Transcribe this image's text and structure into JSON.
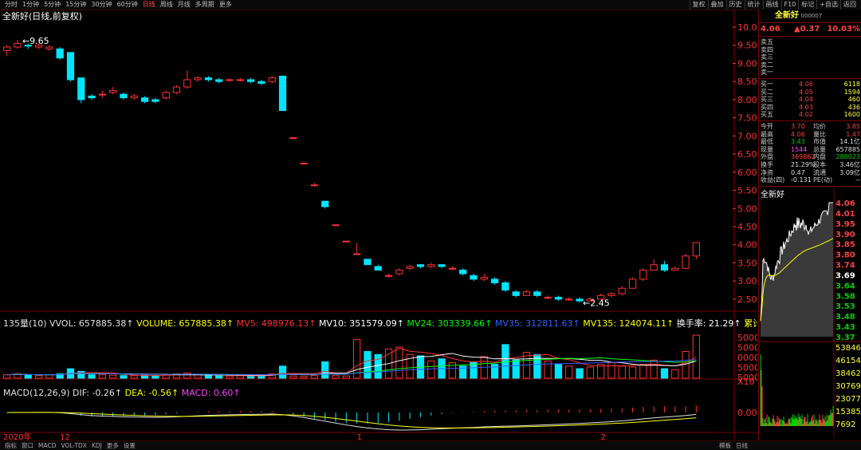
{
  "toolbar": {
    "periods": [
      "分时",
      "1分钟",
      "5分钟",
      "15分钟",
      "30分钟",
      "60分钟",
      "日线",
      "周线",
      "月线",
      "多周期",
      "更多"
    ],
    "active_period": "日线",
    "right_buttons": [
      "复权",
      "叠加",
      "历史",
      "统计",
      "画线",
      "F10",
      "标记",
      "+自选",
      "返回"
    ]
  },
  "chart_title": "全新好(日线,前复权)",
  "price_axis_labels": [
    "10.00",
    "9.50",
    "9.00",
    "8.50",
    "8.00",
    "7.50",
    "7.00",
    "6.50",
    "6.00",
    "5.50",
    "5.00",
    "4.50",
    "4.00",
    "3.50",
    "3.00",
    "2.50"
  ],
  "annotations": {
    "high": "9.65",
    "low": "2.45"
  },
  "volume_legend": [
    {
      "text": "135量(10) VVOL: 657885.38↑",
      "color": "#e0e0e0"
    },
    {
      "text": "VOLUME: 657885.38↑",
      "color": "#ffff00"
    },
    {
      "text": "MV5: 498976.13↑",
      "color": "#ff3030"
    },
    {
      "text": "MV10: 351579.09↑",
      "color": "#ffffff"
    },
    {
      "text": "MV24: 303339.66↑",
      "color": "#00ff00"
    },
    {
      "text": "MV35: 312811.63↑",
      "color": "#3060ff"
    },
    {
      "text": "MV135: 124074.11↑",
      "color": "#ffff00"
    },
    {
      "text": "换手率: 21.29↑",
      "color": "#ffffff"
    },
    {
      "text": "累计换手:",
      "color": "#ffff00"
    }
  ],
  "volume_axis_labels": [
    "5000",
    "5000",
    "0000",
    "5000",
    "5000"
  ],
  "volume_axis_unit": "X10",
  "macd_legend": [
    {
      "text": "MACD(12,26,9) DIF: -0.26↑",
      "color": "#e0e0e0"
    },
    {
      "text": "DEA: -0.56↑",
      "color": "#ffff00"
    },
    {
      "text": "MACD: 0.60↑",
      "color": "#ff40ff"
    }
  ],
  "macd_axis_label": "0.00",
  "date_labels": [
    "2020年",
    "12",
    "1",
    "2"
  ],
  "quote": {
    "name": "全新好",
    "code": "000007",
    "price": "4.06",
    "change": "▲0.37",
    "pct": "10.03%",
    "asks": [
      {
        "label": "卖五",
        "price": "",
        "vol": ""
      },
      {
        "label": "卖四",
        "price": "",
        "vol": ""
      },
      {
        "label": "卖三",
        "price": "",
        "vol": ""
      },
      {
        "label": "卖二",
        "price": "",
        "vol": ""
      },
      {
        "label": "卖一",
        "price": "",
        "vol": ""
      }
    ],
    "bids": [
      {
        "label": "买一",
        "price": "4.06",
        "vol": "6118"
      },
      {
        "label": "买二",
        "price": "4.05",
        "vol": "1594"
      },
      {
        "label": "买三",
        "price": "4.04",
        "vol": "460"
      },
      {
        "label": "买四",
        "price": "4.03",
        "vol": "436"
      },
      {
        "label": "买五",
        "price": "4.02",
        "vol": "1600"
      }
    ],
    "stats": [
      {
        "l1": "今开",
        "v1": "3.70",
        "c1": "#ff4040",
        "l2": "均价",
        "v2": "3.85",
        "c2": "#ff4040"
      },
      {
        "l1": "最高",
        "v1": "4.06",
        "c1": "#ff4040",
        "l2": "量比",
        "v2": "1.47",
        "c2": "#ff4040"
      },
      {
        "l1": "最低",
        "v1": "3.43",
        "c1": "#00d000",
        "l2": "市值",
        "v2": "14.1亿",
        "c2": "#dddddd"
      },
      {
        "l1": "现量",
        "v1": "1544",
        "c1": "#ff40ff",
        "l2": "总量",
        "v2": "657885",
        "c2": "#dddddd"
      },
      {
        "l1": "外盘",
        "v1": "369862",
        "c1": "#ff4040",
        "l2": "内盘",
        "v2": "288023",
        "c2": "#00d000"
      },
      {
        "l1": "换手",
        "v1": "21.29%",
        "c1": "#dddddd",
        "l2": "股本",
        "v2": "3.46亿",
        "c2": "#dddddd"
      },
      {
        "l1": "净资",
        "v1": "0.47",
        "c1": "#dddddd",
        "l2": "流通",
        "v2": "3.09亿",
        "c2": "#dddddd"
      },
      {
        "l1": "收益(四)",
        "v1": "-0.131",
        "c1": "#dddddd",
        "l2": "PE(动)",
        "v2": "--",
        "c2": "#dddddd"
      }
    ]
  },
  "mini_chart": {
    "name": "全新好",
    "price_labels": [
      {
        "v": "4.06",
        "c": "#ff4040"
      },
      {
        "v": "4.01",
        "c": "#ff4040"
      },
      {
        "v": "3.95",
        "c": "#ff4040"
      },
      {
        "v": "3.90",
        "c": "#ff4040"
      },
      {
        "v": "3.85",
        "c": "#ff4040"
      },
      {
        "v": "3.80",
        "c": "#ff4040"
      },
      {
        "v": "3.74",
        "c": "#ff4040"
      },
      {
        "v": "3.69",
        "c": "#ffffff"
      },
      {
        "v": "3.64",
        "c": "#00d000"
      },
      {
        "v": "3.58",
        "c": "#00d000"
      },
      {
        "v": "3.53",
        "c": "#00d000"
      },
      {
        "v": "3.48",
        "c": "#00d000"
      },
      {
        "v": "3.43",
        "c": "#00d000"
      },
      {
        "v": "3.37",
        "c": "#00d000"
      }
    ],
    "vol_labels": [
      "53846",
      "46154",
      "38462",
      "30769",
      "23077",
      "15385",
      "7692"
    ]
  },
  "bottom_tabs": [
    "指标",
    "窗口",
    "MACD",
    "VOL-TDX",
    "KDJ",
    "更多",
    "设置"
  ],
  "bottom_right": [
    "模板",
    "日线"
  ],
  "colors": {
    "up": "#ff3030",
    "down": "#00e5ff",
    "grid_red": "#7a0000"
  },
  "chart_data": {
    "type": "candlestick",
    "title": "全新好(日线,前复权)",
    "y_range": [
      2.3,
      10.0
    ],
    "date_labels": [
      "2020年",
      "12",
      "1",
      "2"
    ],
    "candles": [
      [
        9.35,
        9.45,
        9.2,
        9.5
      ],
      [
        9.45,
        9.55,
        9.4,
        9.65
      ],
      [
        9.5,
        9.48,
        9.4,
        9.55
      ],
      [
        9.45,
        9.5,
        9.4,
        9.55
      ],
      [
        9.4,
        9.45,
        9.35,
        9.5
      ],
      [
        9.4,
        9.15,
        9.1,
        9.45
      ],
      [
        9.3,
        8.55,
        8.5,
        9.3
      ],
      [
        8.6,
        8.0,
        7.9,
        8.6
      ],
      [
        8.1,
        8.05,
        8.0,
        8.15
      ],
      [
        8.15,
        8.15,
        8.05,
        8.25
      ],
      [
        8.2,
        8.25,
        8.15,
        8.35
      ],
      [
        8.15,
        8.05,
        8.0,
        8.2
      ],
      [
        8.05,
        8.1,
        8.0,
        8.15
      ],
      [
        8.05,
        7.95,
        7.9,
        8.1
      ],
      [
        8.0,
        7.95,
        7.9,
        8.05
      ],
      [
        8.05,
        8.2,
        8.0,
        8.25
      ],
      [
        8.2,
        8.35,
        8.15,
        8.4
      ],
      [
        8.35,
        8.55,
        8.3,
        8.8
      ],
      [
        8.55,
        8.6,
        8.5,
        8.65
      ],
      [
        8.6,
        8.55,
        8.5,
        8.65
      ],
      [
        8.55,
        8.5,
        8.45,
        8.6
      ],
      [
        8.55,
        8.55,
        8.5,
        8.6
      ],
      [
        8.55,
        8.55,
        8.5,
        8.6
      ],
      [
        8.55,
        8.5,
        8.45,
        8.6
      ],
      [
        8.5,
        8.45,
        8.4,
        8.55
      ],
      [
        8.5,
        8.6,
        8.45,
        8.65
      ],
      [
        8.65,
        7.7,
        7.7,
        8.65
      ],
      [
        6.95,
        6.95,
        6.95,
        6.95
      ],
      [
        6.25,
        6.25,
        6.25,
        6.25
      ],
      [
        5.65,
        5.65,
        5.6,
        5.7
      ],
      [
        5.2,
        5.05,
        5.0,
        5.2
      ],
      [
        4.55,
        4.55,
        4.55,
        4.55
      ],
      [
        4.1,
        4.1,
        4.1,
        4.1
      ],
      [
        3.75,
        3.75,
        3.75,
        4.05
      ],
      [
        3.6,
        3.45,
        3.45,
        3.6
      ],
      [
        3.4,
        3.3,
        3.3,
        3.45
      ],
      [
        3.15,
        3.15,
        3.1,
        3.2
      ],
      [
        3.2,
        3.3,
        3.15,
        3.35
      ],
      [
        3.35,
        3.4,
        3.3,
        3.45
      ],
      [
        3.45,
        3.4,
        3.35,
        3.45
      ],
      [
        3.4,
        3.45,
        3.35,
        3.5
      ],
      [
        3.45,
        3.4,
        3.35,
        3.45
      ],
      [
        3.35,
        3.35,
        3.3,
        3.4
      ],
      [
        3.3,
        3.2,
        3.15,
        3.35
      ],
      [
        3.15,
        3.05,
        3.0,
        3.2
      ],
      [
        3.05,
        3.1,
        3.0,
        3.2
      ],
      [
        3.05,
        2.95,
        2.9,
        3.1
      ],
      [
        2.95,
        2.75,
        2.7,
        3.0
      ],
      [
        2.7,
        2.6,
        2.55,
        2.75
      ],
      [
        2.6,
        2.7,
        2.6,
        2.75
      ],
      [
        2.7,
        2.6,
        2.55,
        2.75
      ],
      [
        2.55,
        2.55,
        2.5,
        2.6
      ],
      [
        2.55,
        2.5,
        2.45,
        2.6
      ],
      [
        2.5,
        2.5,
        2.45,
        2.55
      ],
      [
        2.5,
        2.45,
        2.4,
        2.55
      ],
      [
        2.45,
        2.5,
        2.45,
        2.55
      ],
      [
        2.5,
        2.6,
        2.5,
        2.65
      ],
      [
        2.6,
        2.65,
        2.55,
        2.7
      ],
      [
        2.65,
        2.8,
        2.6,
        2.85
      ],
      [
        2.8,
        3.05,
        2.8,
        3.1
      ],
      [
        3.05,
        3.3,
        3.0,
        3.35
      ],
      [
        3.3,
        3.45,
        3.3,
        3.6
      ],
      [
        3.45,
        3.3,
        3.25,
        3.55
      ],
      [
        3.3,
        3.35,
        3.3,
        3.4
      ],
      [
        3.35,
        3.69,
        3.35,
        3.75
      ],
      [
        3.69,
        4.06,
        3.6,
        4.06
      ]
    ],
    "volume": [
      0.08,
      0.1,
      0.08,
      0.06,
      0.08,
      0.1,
      0.22,
      0.16,
      0.08,
      0.08,
      0.07,
      0.06,
      0.06,
      0.07,
      0.06,
      0.08,
      0.1,
      0.12,
      0.08,
      0.06,
      0.05,
      0.05,
      0.06,
      0.06,
      0.07,
      0.1,
      0.28,
      0.05,
      0.04,
      0.06,
      0.38,
      0.06,
      0.05,
      0.9,
      0.62,
      0.55,
      0.68,
      0.72,
      0.55,
      0.52,
      0.4,
      0.45,
      0.36,
      0.28,
      0.38,
      0.5,
      0.32,
      0.78,
      0.42,
      0.6,
      0.55,
      0.4,
      0.32,
      0.28,
      0.22,
      0.26,
      0.32,
      0.36,
      0.28,
      0.26,
      0.32,
      0.42,
      0.22,
      0.2,
      0.62,
      1.0
    ]
  }
}
